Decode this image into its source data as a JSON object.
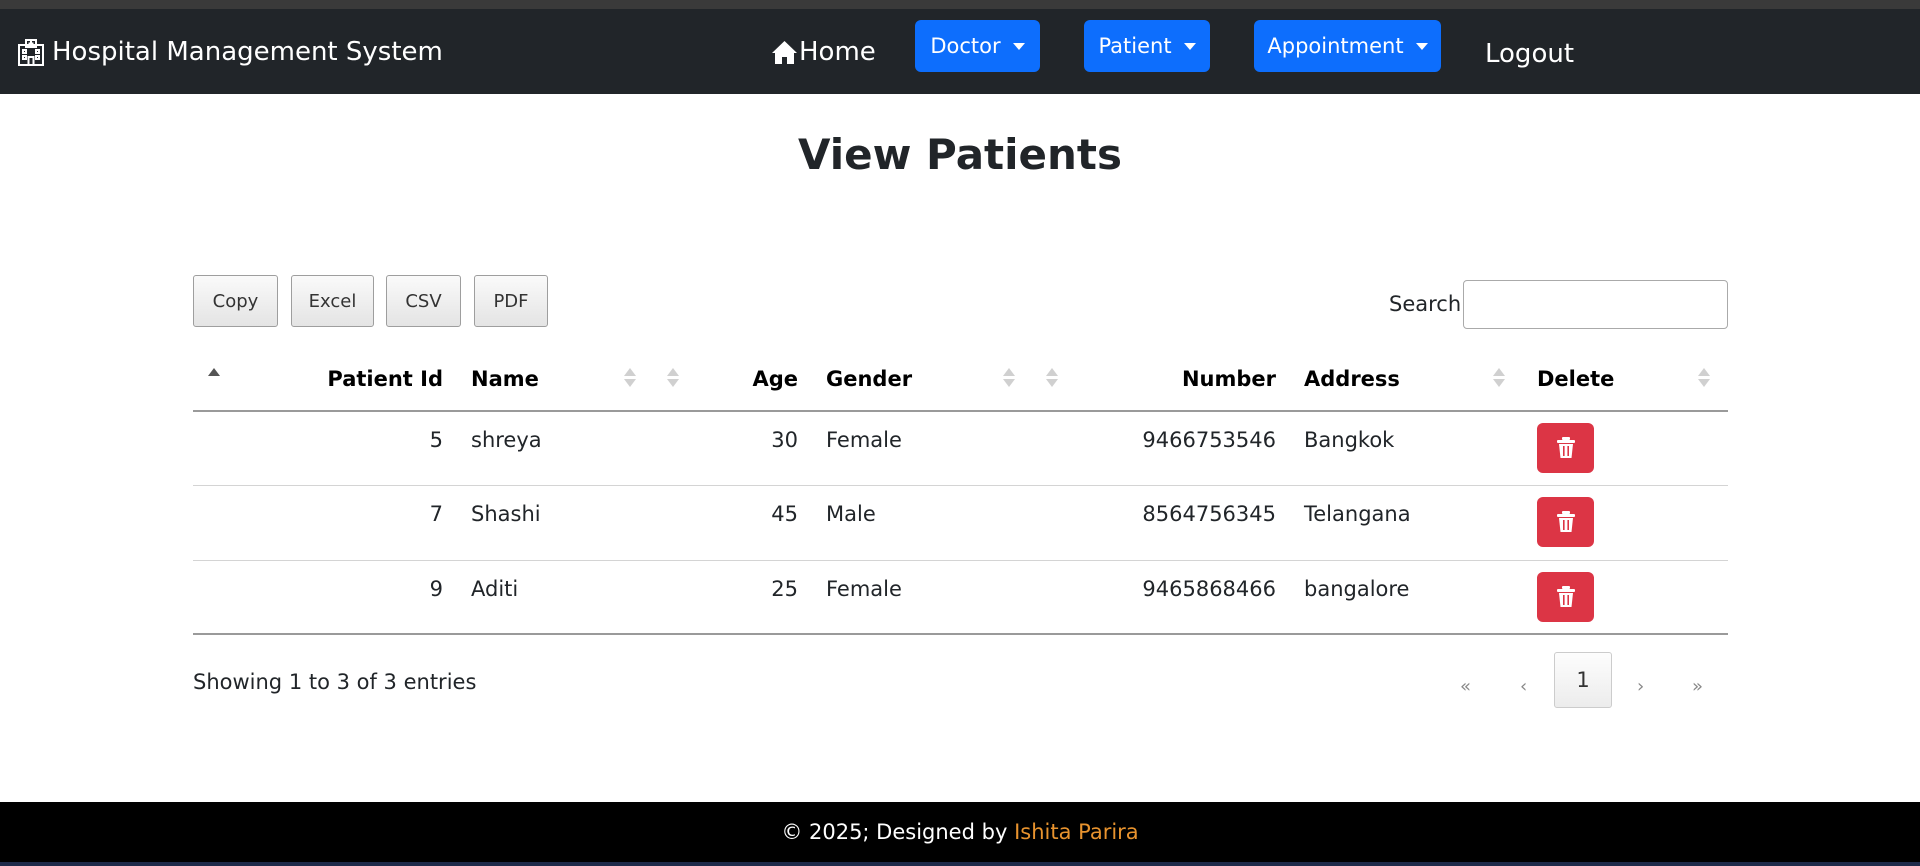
{
  "navbar": {
    "brand": "Hospital Management System",
    "home": "Home",
    "menus": [
      "Doctor",
      "Patient",
      "Appointment"
    ],
    "logout": "Logout"
  },
  "page": {
    "title": "View Patients"
  },
  "export_buttons": [
    "Copy",
    "Excel",
    "CSV",
    "PDF"
  ],
  "search": {
    "label": "Search:",
    "value": "",
    "placeholder": ""
  },
  "table": {
    "columns": [
      "Patient Id",
      "Name",
      "Age",
      "Gender",
      "Number",
      "Address",
      "Delete"
    ],
    "rows": [
      [
        "5",
        "shreya",
        "30",
        "Female",
        "9466753546",
        "Bangkok"
      ],
      [
        "7",
        "Shashi",
        "45",
        "Male",
        "8564756345",
        "Telangana"
      ],
      [
        "9",
        "Aditi",
        "25",
        "Female",
        "9465868466",
        "bangalore"
      ]
    ],
    "delete_icon": "trash-icon"
  },
  "info": "Showing 1 to 3 of 3 entries",
  "pagination": {
    "first": "«",
    "prev": "‹",
    "current": "1",
    "next": "›",
    "last": "»"
  },
  "footer": {
    "text": "© 2025; Designed by",
    "author": "Ishita Parira"
  },
  "colors": {
    "navbar": "#212529",
    "primary": "#0d6efd",
    "danger": "#dc3545",
    "footer": "#000000",
    "author_link": "#e8932e"
  }
}
